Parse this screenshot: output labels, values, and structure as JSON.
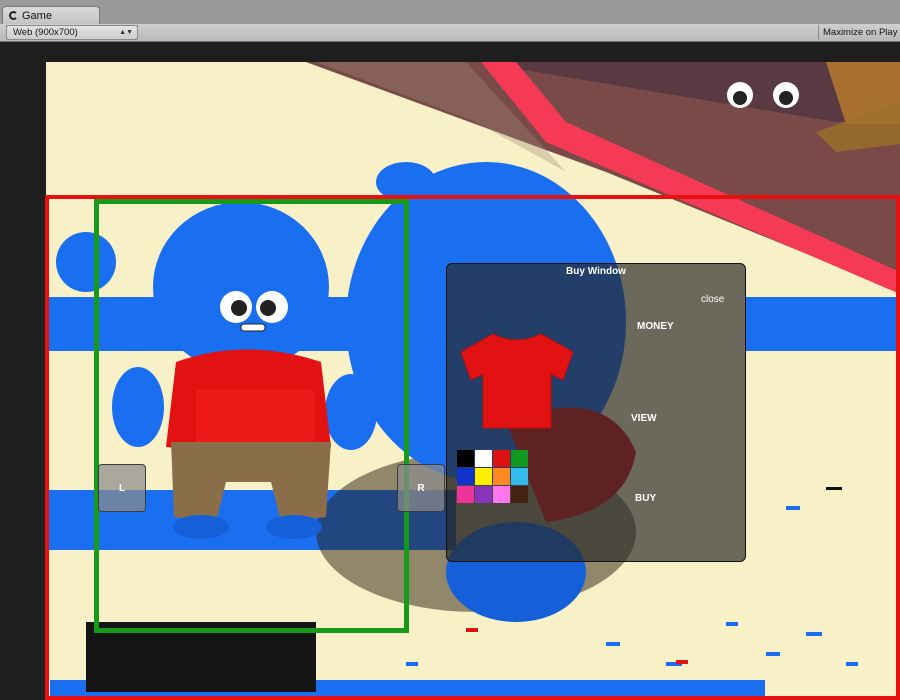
{
  "editor": {
    "tab_label": "Game",
    "aspect_label": "Web (900x700)",
    "maximize_label": "Maximize on Play"
  },
  "game": {
    "left_button": "L",
    "right_button": "R",
    "buy_window": {
      "title": "Buy Window",
      "close": "close",
      "money": "MONEY",
      "view": "VIEW",
      "buy": "BUY",
      "item_color": "#e31212",
      "swatches": [
        "#000000",
        "#ffffff",
        "#dd1111",
        "#119922",
        "#1133cc",
        "#ffee00",
        "#ff8822",
        "#33bbee",
        "#ee3399",
        "#8833bb",
        "#ff77ee",
        "#442211"
      ]
    }
  },
  "colors": {
    "character_body": "#1a6ef0",
    "shirt": "#e31212",
    "pants": "#8a6e4a",
    "red_frame": "#e81010",
    "green_frame": "#17991a"
  }
}
